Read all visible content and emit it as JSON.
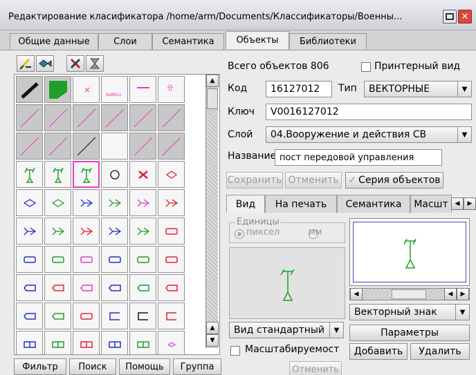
{
  "window": {
    "title": "Редактирование класификатора /home/arm/Documents/Классификаторы/Военны...",
    "maximize_icon": "maximize-icon",
    "close_icon": "close-icon"
  },
  "top_tabs": [
    {
      "label": "Общие данные",
      "active": false
    },
    {
      "label": "Слои",
      "active": false
    },
    {
      "label": "Семантика",
      "active": false
    },
    {
      "label": "Объекты",
      "active": true
    },
    {
      "label": "Библиотеки",
      "active": false
    }
  ],
  "toolbar": {
    "icons": [
      "edit-pen-icon",
      "fish-icon",
      "delete-cross-icon",
      "hourglass-icon"
    ]
  },
  "bottom_buttons": {
    "filter": "Фильтр",
    "search": "Поиск",
    "help": "Помощь",
    "group": "Группа"
  },
  "info": {
    "total_label": "Всего объектов 806",
    "printer_view_label": "Принтерный вид",
    "printer_view_checked": false
  },
  "form": {
    "code_label": "Код",
    "code_value": "16127012",
    "type_label": "Тип",
    "type_value": "ВЕКТОРНЫЕ",
    "key_label": "Ключ",
    "key_value": "V0016127012",
    "layer_label": "Слой",
    "layer_value": "04.Вооружение и действия СВ",
    "name_label": "Название",
    "name_value": "пост передовой управления"
  },
  "actions": {
    "save": "Сохранить",
    "cancel": "Отменить",
    "series": "Серия объектов"
  },
  "inner_tabs": [
    {
      "label": "Вид",
      "active": true
    },
    {
      "label": "На печать",
      "active": false
    },
    {
      "label": "Семантика",
      "active": false
    },
    {
      "label": "Масшт",
      "active": false
    }
  ],
  "units": {
    "legend": "Единицы",
    "pixel": "пиксел",
    "mm": "мм",
    "selected": "pixel"
  },
  "view": {
    "view_combo": "Вид стандартный",
    "scalable_label": "Масштабируемост",
    "scalable_checked": false,
    "cancel": "Отменить"
  },
  "right_panel": {
    "sign_type": "Векторный знак",
    "params": "Параметры",
    "add": "Добавить",
    "delete": "Удалить"
  },
  "grid_icons": [
    [
      "knife-icon",
      "green-polygon-icon",
      "small-cross-icon",
      "small-text-icon",
      "magenta-line-icon",
      "magenta-mark-icon"
    ],
    [
      "diagonal-line-icon",
      "diagonal-line-icon",
      "diagonal-line-icon",
      "diagonal-line-icon",
      "diagonal-line-icon",
      "diagonal-line-icon"
    ],
    [
      "diagonal-line-icon",
      "diagonal-line-icon",
      "black-diagonal-icon",
      "blank-icon",
      "diagonal-line-icon",
      "diagonal-line-icon"
    ],
    [
      "antenna-post-icon",
      "antenna-small-icon",
      "antenna-selected-icon",
      "circle-icon",
      "cross-arrow-icon",
      "diamond-icon"
    ],
    [
      "blue-diamond-icon",
      "green-diamond-icon",
      "blue-arrow-icon",
      "green-arrow-icon",
      "magenta-arrow-icon",
      "red-arrow-icon"
    ],
    [
      "blue-arrow-icon",
      "green-arrow-icon",
      "red-arrow-icon",
      "blue-arrow-icon",
      "green-arrow-icon",
      "red-rect-icon"
    ],
    [
      "blue-rect-icon",
      "green-rect-icon",
      "magenta-rect-icon",
      "blue-rect-icon",
      "green-rect-icon",
      "red-rect-icon"
    ],
    [
      "blue-tag-icon",
      "red-tag-icon",
      "magenta-tag-icon",
      "blue-tag-icon",
      "green-tag-icon",
      "red-tag-icon"
    ],
    [
      "blue-tag-icon",
      "green-tag-icon",
      "red-big-rect-icon",
      "blue-bracket-icon",
      "black-bracket-icon",
      "red-bracket-icon"
    ],
    [
      "blue-double-icon",
      "green-double-icon",
      "red-double-icon",
      "blue-double-icon",
      "green-double-icon",
      "red-small-icon"
    ]
  ],
  "selected_cell": {
    "row": 3,
    "col": 2
  },
  "colors": {
    "accent_selection": "#e040c0",
    "symbol_green": "#1f9e2a",
    "preview_border": "#5040c0"
  }
}
